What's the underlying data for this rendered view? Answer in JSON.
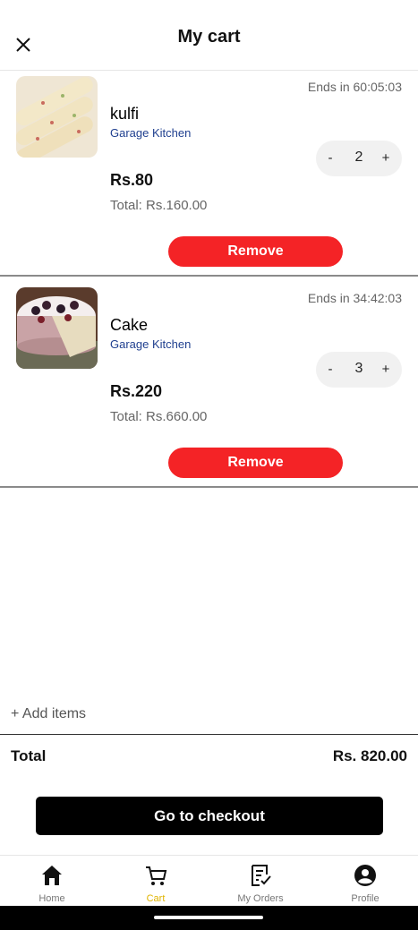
{
  "header": {
    "title": "My cart",
    "close_icon": "close-icon"
  },
  "cart": {
    "items": [
      {
        "name": "kulfi",
        "vendor": "Garage Kitchen",
        "ends": "Ends in 60:05:03",
        "price": "Rs.80",
        "total": "Total: Rs.160.00",
        "qty": "2",
        "minus": "-",
        "plus": "+",
        "remove_label": "Remove",
        "image": "kulfi-photo"
      },
      {
        "name": "Cake",
        "vendor": "Garage Kitchen",
        "ends": "Ends in 34:42:03",
        "price": "Rs.220",
        "total": "Total: Rs.660.00",
        "qty": "3",
        "minus": "-",
        "plus": "+",
        "remove_label": "Remove",
        "image": "cake-photo"
      }
    ],
    "add_items": "+ Add items",
    "total_label": "Total",
    "total_value": "Rs. 820.00",
    "checkout_label": "Go to checkout"
  },
  "nav": {
    "items": [
      {
        "label": "Home",
        "icon": "home-icon",
        "active": false
      },
      {
        "label": "Cart",
        "icon": "cart-icon",
        "active": true
      },
      {
        "label": "My Orders",
        "icon": "orders-icon",
        "active": false
      },
      {
        "label": "Profile",
        "icon": "profile-icon",
        "active": false
      }
    ]
  },
  "colors": {
    "remove": "#f42326",
    "checkout": "#000000",
    "active_nav": "#e0b400",
    "vendor": "#1f3f8f"
  }
}
